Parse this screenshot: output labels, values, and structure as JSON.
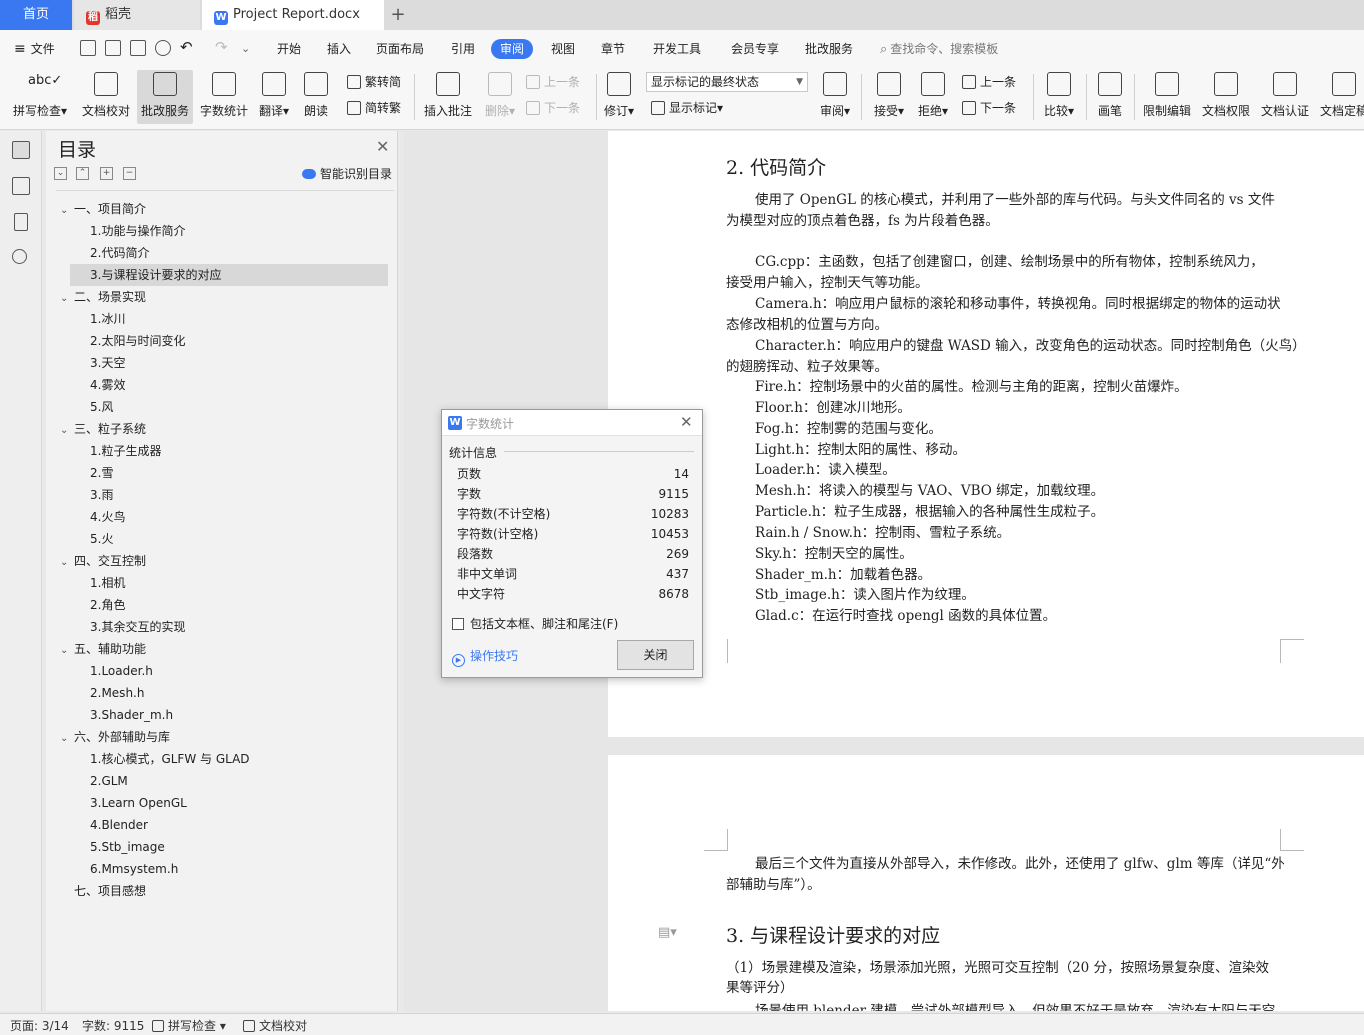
{
  "tabs": {
    "home": "首页",
    "daoke": "稻壳",
    "document": "Project Report.docx",
    "add": "+"
  },
  "menu": {
    "file": "文件",
    "items": [
      "开始",
      "插入",
      "页面布局",
      "引用",
      "审阅",
      "视图",
      "章节",
      "开发工具",
      "会员专享",
      "批改服务"
    ],
    "active": "审阅",
    "search_placeholder": "查找命令、搜索模板"
  },
  "ribbon": {
    "spell_check": "拼写检查",
    "doc_proof": "文档校对",
    "correction_service": "批改服务",
    "word_count": "字数统计",
    "translate": "翻译",
    "read_aloud": "朗读",
    "trad_to_simp": "繁转简",
    "simp_to_trad": "简转繁",
    "insert_comment": "插入批注",
    "delete": "删除",
    "prev_comment": "上一条",
    "next_comment": "下一条",
    "track_changes": "修订",
    "markup_select": "显示标记的最终状态",
    "show_markup": "显示标记",
    "review": "审阅",
    "accept": "接受",
    "reject": "拒绝",
    "prev_change": "上一条",
    "next_change": "下一条",
    "compare": "比较",
    "pen": "画笔",
    "restrict_edit": "限制编辑",
    "doc_permission": "文档权限",
    "doc_certify": "文档认证",
    "doc_final": "文档定稿"
  },
  "toc": {
    "title": "目录",
    "smart_label": "智能识别目录",
    "items": [
      {
        "level": 1,
        "text": "一、项目简介"
      },
      {
        "level": 2,
        "text": "1.功能与操作简介"
      },
      {
        "level": 2,
        "text": "2.代码简介"
      },
      {
        "level": 2,
        "text": "3.与课程设计要求的对应",
        "selected": true
      },
      {
        "level": 1,
        "text": "二、场景实现"
      },
      {
        "level": 2,
        "text": "1.冰川"
      },
      {
        "level": 2,
        "text": "2.太阳与时间变化"
      },
      {
        "level": 2,
        "text": "3.天空"
      },
      {
        "level": 2,
        "text": "4.雾效"
      },
      {
        "level": 2,
        "text": "5.风"
      },
      {
        "level": 1,
        "text": "三、粒子系统"
      },
      {
        "level": 2,
        "text": "1.粒子生成器"
      },
      {
        "level": 2,
        "text": "2.雪"
      },
      {
        "level": 2,
        "text": "3.雨"
      },
      {
        "level": 2,
        "text": "4.火鸟"
      },
      {
        "level": 2,
        "text": "5.火"
      },
      {
        "level": 1,
        "text": "四、交互控制"
      },
      {
        "level": 2,
        "text": "1.相机"
      },
      {
        "level": 2,
        "text": "2.角色"
      },
      {
        "level": 2,
        "text": "3.其余交互的实现"
      },
      {
        "level": 1,
        "text": "五、辅助功能"
      },
      {
        "level": 2,
        "text": "1.Loader.h"
      },
      {
        "level": 2,
        "text": "2.Mesh.h"
      },
      {
        "level": 2,
        "text": "3.Shader_m.h"
      },
      {
        "level": 1,
        "text": "六、外部辅助与库"
      },
      {
        "level": 2,
        "text": "1.核心模式，GLFW 与 GLAD"
      },
      {
        "level": 2,
        "text": "2.GLM"
      },
      {
        "level": 2,
        "text": "3.Learn OpenGL"
      },
      {
        "level": 2,
        "text": "4.Blender"
      },
      {
        "level": 2,
        "text": "5.Stb_image"
      },
      {
        "level": 2,
        "text": "6.Mmsystem.h"
      },
      {
        "level": 1,
        "text": "七、项目感想",
        "no_chevron": true
      }
    ]
  },
  "document": {
    "page1": {
      "heading": "2. 代码简介",
      "lines": [
        "使用了 OpenGL 的核心模式，并利用了一些外部的库与代码。与头文件同名的 vs 文件",
        "为模型对应的顶点着色器，fs 为片段着色器。",
        "",
        "CG.cpp：主函数，包括了创建窗口，创建、绘制场景中的所有物体，控制系统风力，",
        "接受用户输入，控制天气等功能。",
        "Camera.h：响应用户鼠标的滚轮和移动事件，转换视角。同时根据绑定的物体的运动状",
        "态修改相机的位置与方向。",
        "Character.h：响应用户的键盘 WASD 输入，改变角色的运动状态。同时控制角色（火鸟）",
        "的翅膀挥动、粒子效果等。",
        "Fire.h：控制场景中的火苗的属性。检测与主角的距离，控制火苗爆炸。",
        "Floor.h：创建冰川地形。",
        "Fog.h：控制雾的范围与变化。",
        "Light.h：控制太阳的属性、移动。",
        "Loader.h：读入模型。",
        "Mesh.h：将读入的模型与 VAO、VBO 绑定，加载纹理。",
        "Particle.h：粒子生成器，根据输入的各种属性生成粒子。",
        "Rain.h / Snow.h：控制雨、雪粒子系统。",
        "Sky.h：控制天空的属性。",
        "Shader_m.h：加载着色器。",
        "Stb_image.h：读入图片作为纹理。",
        "Glad.c：在运行时查找 opengl 函数的具体位置。"
      ]
    },
    "page2": {
      "lines": [
        "最后三个文件为直接从外部导入，未作修改。此外，还使用了 glfw、glm 等库（详见“外",
        "部辅助与库”）。"
      ],
      "heading": "3. 与课程设计要求的对应",
      "para": [
        "（1）场景建模及渲染，场景添加光照，光照可交互控制（20 分，按照场景复杂度、渲染效",
        "果等评分）",
        "场景使用 blender 建模，尝试外部模型导入，但效果不好于是放弃。渲染有太阳与天空"
      ]
    }
  },
  "dialog": {
    "title": "字数统计",
    "section": "统计信息",
    "rows": [
      {
        "label": "页数",
        "value": "14"
      },
      {
        "label": "字数",
        "value": "9115"
      },
      {
        "label": "字符数(不计空格)",
        "value": "10283"
      },
      {
        "label": "字符数(计空格)",
        "value": "10453"
      },
      {
        "label": "段落数",
        "value": "269"
      },
      {
        "label": "非中文单词",
        "value": "437"
      },
      {
        "label": "中文字符",
        "value": "8678"
      }
    ],
    "checkbox_label": "包括文本框、脚注和尾注(F)",
    "tips": "操作技巧",
    "close": "关闭"
  },
  "status": {
    "page": "页面: 3/14",
    "words": "字数: 9115",
    "spell": "拼写检查",
    "proof": "文档校对"
  },
  "colors": {
    "accent": "#3a78f2",
    "wps_red": "#e2362d"
  }
}
